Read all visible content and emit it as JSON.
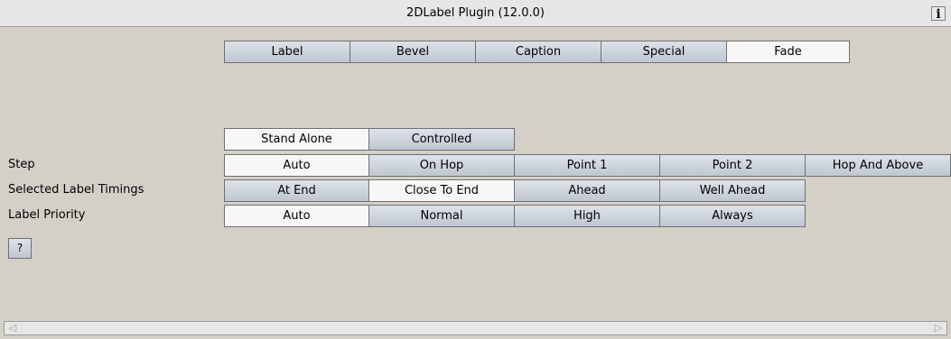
{
  "window": {
    "title": "2DLabel Plugin (12.0.0)",
    "info_icon": "i"
  },
  "tabs": [
    {
      "label": "Label",
      "selected": false
    },
    {
      "label": "Bevel",
      "selected": false
    },
    {
      "label": "Caption",
      "selected": false
    },
    {
      "label": "Special",
      "selected": false
    },
    {
      "label": "Fade",
      "selected": true
    }
  ],
  "mode": [
    {
      "label": "Stand Alone",
      "selected": true
    },
    {
      "label": "Controlled",
      "selected": false
    }
  ],
  "step": {
    "label": "Step",
    "options": [
      "Auto",
      "On Hop",
      "Point 1",
      "Point 2",
      "Hop And Above"
    ],
    "selected": "Auto"
  },
  "timings": {
    "label": "Selected Label Timings",
    "options": [
      "At End",
      "Close To End",
      "Ahead",
      "Well Ahead"
    ],
    "selected": "Close To End"
  },
  "priority": {
    "label": "Label Priority",
    "options": [
      "Auto",
      "Normal",
      "High",
      "Always"
    ],
    "selected": "Auto"
  },
  "help_button": "?",
  "scrollbar": {
    "left_arrow": "◁",
    "right_arrow": "▷"
  }
}
